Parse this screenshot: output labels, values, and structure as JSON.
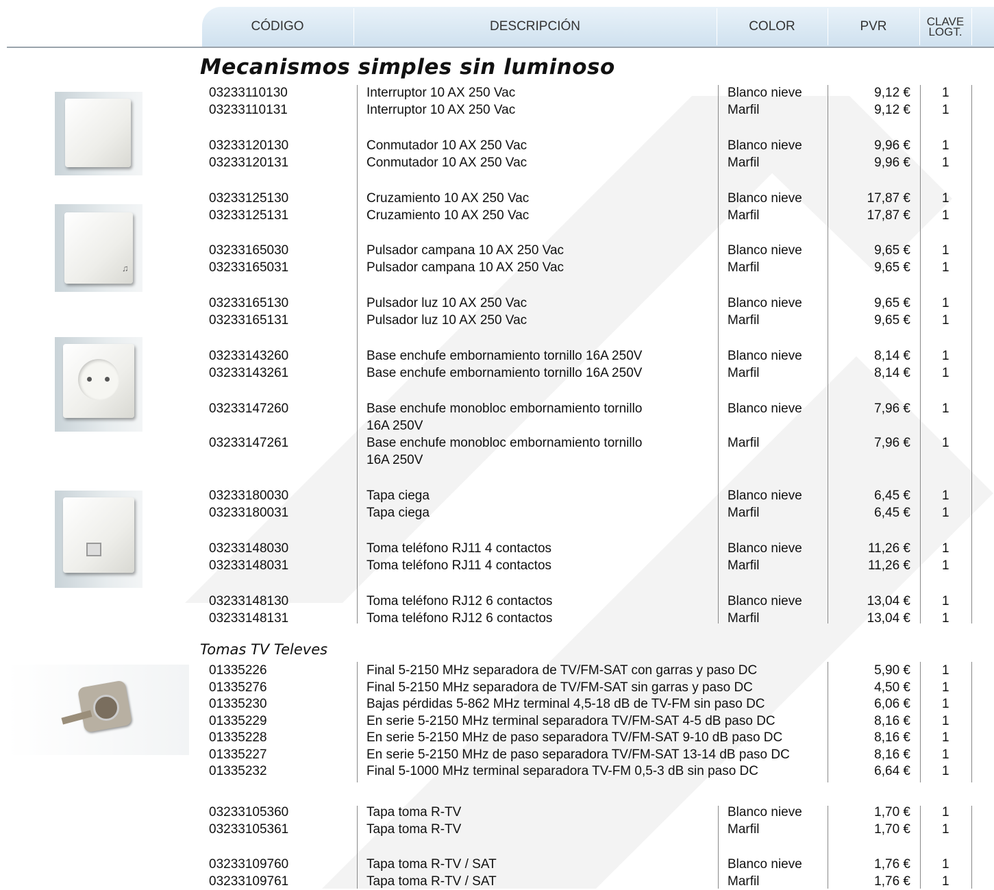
{
  "header": {
    "codigo": "CÓDIGO",
    "descripcion": "DESCRIPCIÓN",
    "color": "COLOR",
    "pvr": "PVR",
    "clave_line1": "CLAVE",
    "clave_line2": "LOGT."
  },
  "section1": {
    "title": "Mecanismos simples sin luminoso",
    "rows": [
      {
        "code": "03233110130",
        "desc": "Interruptor 10 AX 250 Vac",
        "color": "Blanco nieve",
        "price": "9,12 €",
        "clave": "1"
      },
      {
        "code": "03233110131",
        "desc": "Interruptor 10 AX 250 Vac",
        "color": "Marfil",
        "price": "9,12 €",
        "clave": "1"
      },
      {
        "code": "03233120130",
        "desc": "Conmutador 10 AX 250 Vac",
        "color": "Blanco nieve",
        "price": "9,96 €",
        "clave": "1"
      },
      {
        "code": "03233120131",
        "desc": "Conmutador 10 AX 250 Vac",
        "color": "Marfil",
        "price": "9,96 €",
        "clave": "1"
      },
      {
        "code": "03233125130",
        "desc": "Cruzamiento 10 AX 250 Vac",
        "color": "Blanco nieve",
        "price": "17,87 €",
        "clave": "1"
      },
      {
        "code": "03233125131",
        "desc": "Cruzamiento 10 AX 250 Vac",
        "color": "Marfil",
        "price": "17,87 €",
        "clave": "1"
      },
      {
        "code": "03233165030",
        "desc": "Pulsador campana 10 AX 250 Vac",
        "color": "Blanco nieve",
        "price": "9,65 €",
        "clave": "1"
      },
      {
        "code": "03233165031",
        "desc": "Pulsador campana 10 AX 250 Vac",
        "color": "Marfil",
        "price": "9,65 €",
        "clave": "1"
      },
      {
        "code": "03233165130",
        "desc": "Pulsador luz 10 AX 250 Vac",
        "color": "Blanco nieve",
        "price": "9,65 €",
        "clave": "1"
      },
      {
        "code": "03233165131",
        "desc": "Pulsador luz 10 AX 250 Vac",
        "color": "Marfil",
        "price": "9,65 €",
        "clave": "1"
      },
      {
        "code": "03233143260",
        "desc": "Base enchufe embornamiento tornillo 16A 250V",
        "color": "Blanco nieve",
        "price": "8,14 €",
        "clave": "1"
      },
      {
        "code": "03233143261",
        "desc": "Base enchufe embornamiento tornillo 16A 250V",
        "color": "Marfil",
        "price": "8,14 €",
        "clave": "1"
      },
      {
        "code": "03233147260",
        "desc": "Base enchufe monobloc embornamiento tornillo",
        "desc2": "16A 250V",
        "color": "Blanco nieve",
        "price": "7,96 €",
        "clave": "1"
      },
      {
        "code": "03233147261",
        "desc": "Base enchufe monobloc embornamiento tornillo",
        "desc2": "16A 250V",
        "color": "Marfil",
        "price": "7,96 €",
        "clave": "1"
      },
      {
        "code": "03233180030",
        "desc": "Tapa ciega",
        "color": "Blanco nieve",
        "price": "6,45 €",
        "clave": "1"
      },
      {
        "code": "03233180031",
        "desc": "Tapa ciega",
        "color": "Marfil",
        "price": "6,45 €",
        "clave": "1"
      },
      {
        "code": "03233148030",
        "desc": "Toma teléfono RJ11 4 contactos",
        "color": "Blanco nieve",
        "price": "11,26 €",
        "clave": "1"
      },
      {
        "code": "03233148031",
        "desc": "Toma teléfono RJ11 4 contactos",
        "color": "Marfil",
        "price": "11,26 €",
        "clave": "1"
      },
      {
        "code": "03233148130",
        "desc": "Toma teléfono RJ12 6 contactos",
        "color": "Blanco nieve",
        "price": "13,04 €",
        "clave": "1"
      },
      {
        "code": "03233148131",
        "desc": "Toma teléfono RJ12 6 contactos",
        "color": "Marfil",
        "price": "13,04 €",
        "clave": "1"
      }
    ]
  },
  "section2": {
    "title": "Tomas TV Televes",
    "rows": [
      {
        "code": "01335226",
        "desc": "Final 5-2150 MHz separadora de TV/FM-SAT con garras y paso DC",
        "price": "5,90 €",
        "clave": "1"
      },
      {
        "code": "01335276",
        "desc": "Final 5-2150 MHz separadora de TV/FM-SAT sin garras y paso DC",
        "price": "4,50 €",
        "clave": "1"
      },
      {
        "code": "01335230",
        "desc": "Bajas pérdidas 5-862 MHz terminal 4,5-18 dB de TV-FM sin paso DC",
        "price": "6,06 €",
        "clave": "1"
      },
      {
        "code": "01335229",
        "desc": "En serie 5-2150 MHz terminal separadora TV/FM-SAT 4-5 dB paso DC",
        "price": "8,16 €",
        "clave": "1"
      },
      {
        "code": "01335228",
        "desc": "En serie 5-2150 MHz de paso separadora TV/FM-SAT 9-10 dB paso DC",
        "price": "8,16 €",
        "clave": "1"
      },
      {
        "code": "01335227",
        "desc": "En serie 5-2150 MHz de paso separadora TV/FM-SAT 13-14 dB paso DC",
        "price": "8,16 €",
        "clave": "1"
      },
      {
        "code": "01335232",
        "desc": "Final 5-1000 MHz terminal separadora TV-FM 0,5-3 dB sin paso DC",
        "price": "6,64 €",
        "clave": "1"
      }
    ],
    "rows_tapa": [
      {
        "code": "03233105360",
        "desc": "Tapa toma R-TV",
        "color": "Blanco nieve",
        "price": "1,70 €",
        "clave": "1"
      },
      {
        "code": "03233105361",
        "desc": "Tapa toma R-TV",
        "color": "Marfil",
        "price": "1,70 €",
        "clave": "1"
      },
      {
        "code": "03233109760",
        "desc": "Tapa toma R-TV / SAT",
        "color": "Blanco nieve",
        "price": "1,76 €",
        "clave": "1"
      },
      {
        "code": "03233109761",
        "desc": "Tapa toma R-TV / SAT",
        "color": "Marfil",
        "price": "1,76 €",
        "clave": "1"
      }
    ]
  },
  "icons": [
    "switch-plate-image",
    "bell-push-plate-image",
    "socket-plate-image",
    "phone-jack-plate-image",
    "tv-socket-image"
  ]
}
